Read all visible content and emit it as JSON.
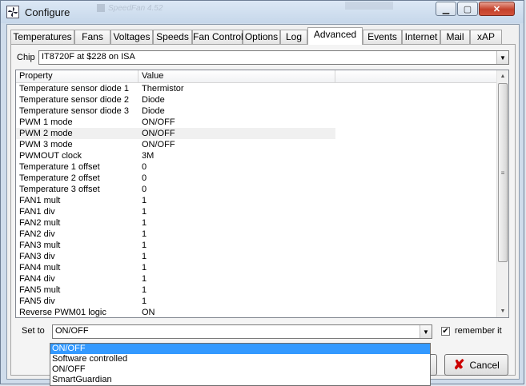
{
  "window": {
    "title": "Configure",
    "ghost_title": "SpeedFan 4.52"
  },
  "tabs": [
    {
      "label": "Temperatures"
    },
    {
      "label": "Fans"
    },
    {
      "label": "Voltages"
    },
    {
      "label": "Speeds"
    },
    {
      "label": "Fan Control"
    },
    {
      "label": "Options"
    },
    {
      "label": "Log"
    },
    {
      "label": "Advanced"
    },
    {
      "label": "Events"
    },
    {
      "label": "Internet"
    },
    {
      "label": "Mail"
    },
    {
      "label": "xAP"
    }
  ],
  "active_tab": "Advanced",
  "chip": {
    "label": "Chip",
    "value": "IT8720F at $228 on ISA"
  },
  "table": {
    "headers": [
      "Property",
      "Value"
    ],
    "rows": [
      {
        "property": "Temperature sensor diode 1",
        "value": "Thermistor"
      },
      {
        "property": "Temperature sensor diode 2",
        "value": "Diode"
      },
      {
        "property": "Temperature sensor diode 3",
        "value": "Diode"
      },
      {
        "property": "PWM 1 mode",
        "value": "ON/OFF"
      },
      {
        "property": "PWM 2 mode",
        "value": "ON/OFF",
        "selected": true
      },
      {
        "property": "PWM 3 mode",
        "value": "ON/OFF"
      },
      {
        "property": "PWMOUT clock",
        "value": "3M"
      },
      {
        "property": "Temperature 1 offset",
        "value": "0"
      },
      {
        "property": "Temperature 2 offset",
        "value": "0"
      },
      {
        "property": "Temperature 3 offset",
        "value": "0"
      },
      {
        "property": "FAN1 mult",
        "value": "1"
      },
      {
        "property": "FAN1 div",
        "value": "1"
      },
      {
        "property": "FAN2 mult",
        "value": "1"
      },
      {
        "property": "FAN2 div",
        "value": "1"
      },
      {
        "property": "FAN3 mult",
        "value": "1"
      },
      {
        "property": "FAN3 div",
        "value": "1"
      },
      {
        "property": "FAN4 mult",
        "value": "1"
      },
      {
        "property": "FAN4 div",
        "value": "1"
      },
      {
        "property": "FAN5 mult",
        "value": "1"
      },
      {
        "property": "FAN5 div",
        "value": "1"
      },
      {
        "property": "Reverse PWM01 logic",
        "value": "ON"
      }
    ]
  },
  "set_to": {
    "label": "Set to",
    "value": "ON/OFF"
  },
  "remember": {
    "label": "remember it",
    "checked": true,
    "mark": "✔"
  },
  "dropdown_options": [
    {
      "label": "ON/OFF",
      "highlighted": true
    },
    {
      "label": "Software controlled"
    },
    {
      "label": "ON/OFF"
    },
    {
      "label": "SmartGuardian"
    }
  ],
  "buttons": {
    "cancel": "Cancel"
  }
}
